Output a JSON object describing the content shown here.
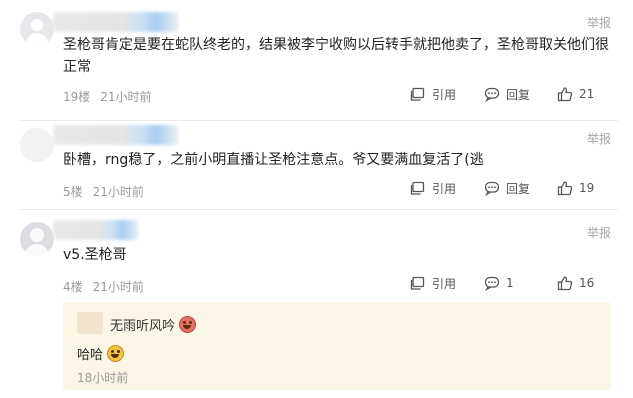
{
  "comments": [
    {
      "report_label": "举报",
      "text": "圣枪哥肯定是要在蛇队终老的，结果被李宁收购以后转手就把他卖了，圣枪哥取关他们很正常",
      "floor": "19楼",
      "time": "21小时前",
      "quote_label": "引用",
      "reply_label": "回复",
      "likes": "21"
    },
    {
      "report_label": "举报",
      "text": "卧槽，rng稳了，之前小明直播让圣枪注意点。爷又要满血复活了(逃",
      "floor": "5楼",
      "time": "21小时前",
      "quote_label": "引用",
      "reply_label": "回复",
      "likes": "19"
    },
    {
      "report_label": "举报",
      "text": "v5.圣枪哥",
      "floor": "4楼",
      "time": "21小时前",
      "quote_label": "引用",
      "reply_count": "1",
      "likes": "16",
      "reply": {
        "username": "无雨听风吟",
        "text": "哈哈",
        "time": "18小时前"
      }
    }
  ]
}
